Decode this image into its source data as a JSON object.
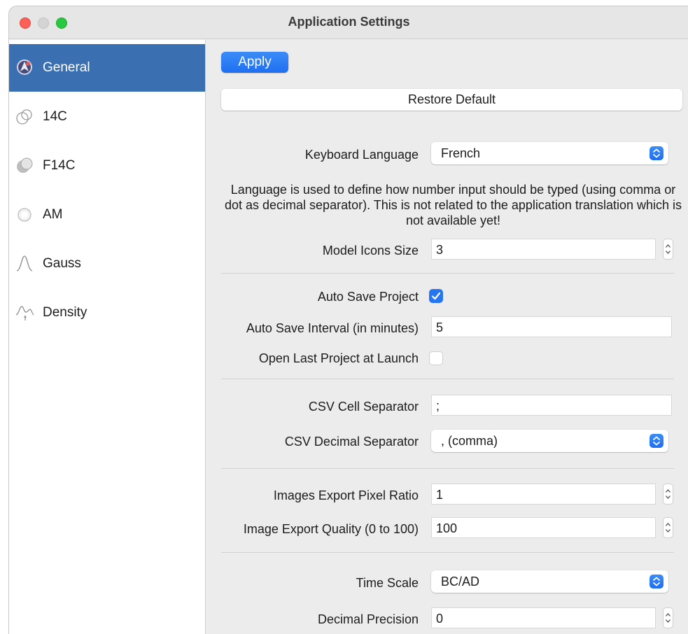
{
  "window": {
    "title": "Application Settings"
  },
  "sidebar": {
    "items": [
      {
        "label": "General",
        "icon": "general-icon",
        "selected": true
      },
      {
        "label": "14C",
        "icon": "14c-icon",
        "selected": false
      },
      {
        "label": "F14C",
        "icon": "f14c-icon",
        "selected": false
      },
      {
        "label": "AM",
        "icon": "am-icon",
        "selected": false
      },
      {
        "label": "Gauss",
        "icon": "gauss-icon",
        "selected": false
      },
      {
        "label": "Density",
        "icon": "density-icon",
        "selected": false
      }
    ]
  },
  "actions": {
    "apply_label": "Apply",
    "restore_label": "Restore Default"
  },
  "settings": {
    "keyboard_language": {
      "label": "Keyboard Language",
      "value": "French"
    },
    "language_note": "Language is used to define how number input should be typed (using comma or dot as decimal separator). This is not related to the application translation which is not available yet!",
    "model_icons_size": {
      "label": "Model Icons Size",
      "value": "3"
    },
    "auto_save_project": {
      "label": "Auto Save Project",
      "checked": true
    },
    "auto_save_interval": {
      "label": "Auto Save Interval (in minutes)",
      "value": "5"
    },
    "open_last_project": {
      "label": "Open Last Project at Launch",
      "checked": false
    },
    "csv_cell_separator": {
      "label": "CSV Cell Separator",
      "value": ";"
    },
    "csv_decimal_separator": {
      "label": "CSV Decimal Separator",
      "value": ", (comma)"
    },
    "images_export_pixel_ratio": {
      "label": "Images Export Pixel Ratio",
      "value": "1"
    },
    "image_export_quality": {
      "label": "Image Export Quality (0 to 100)",
      "value": "100"
    },
    "time_scale": {
      "label": "Time Scale",
      "value": "BC/AD"
    },
    "decimal_precision": {
      "label": "Decimal Precision",
      "value": "0"
    }
  },
  "colors": {
    "accent": "#2576f0",
    "selection": "#3a6fb1"
  }
}
